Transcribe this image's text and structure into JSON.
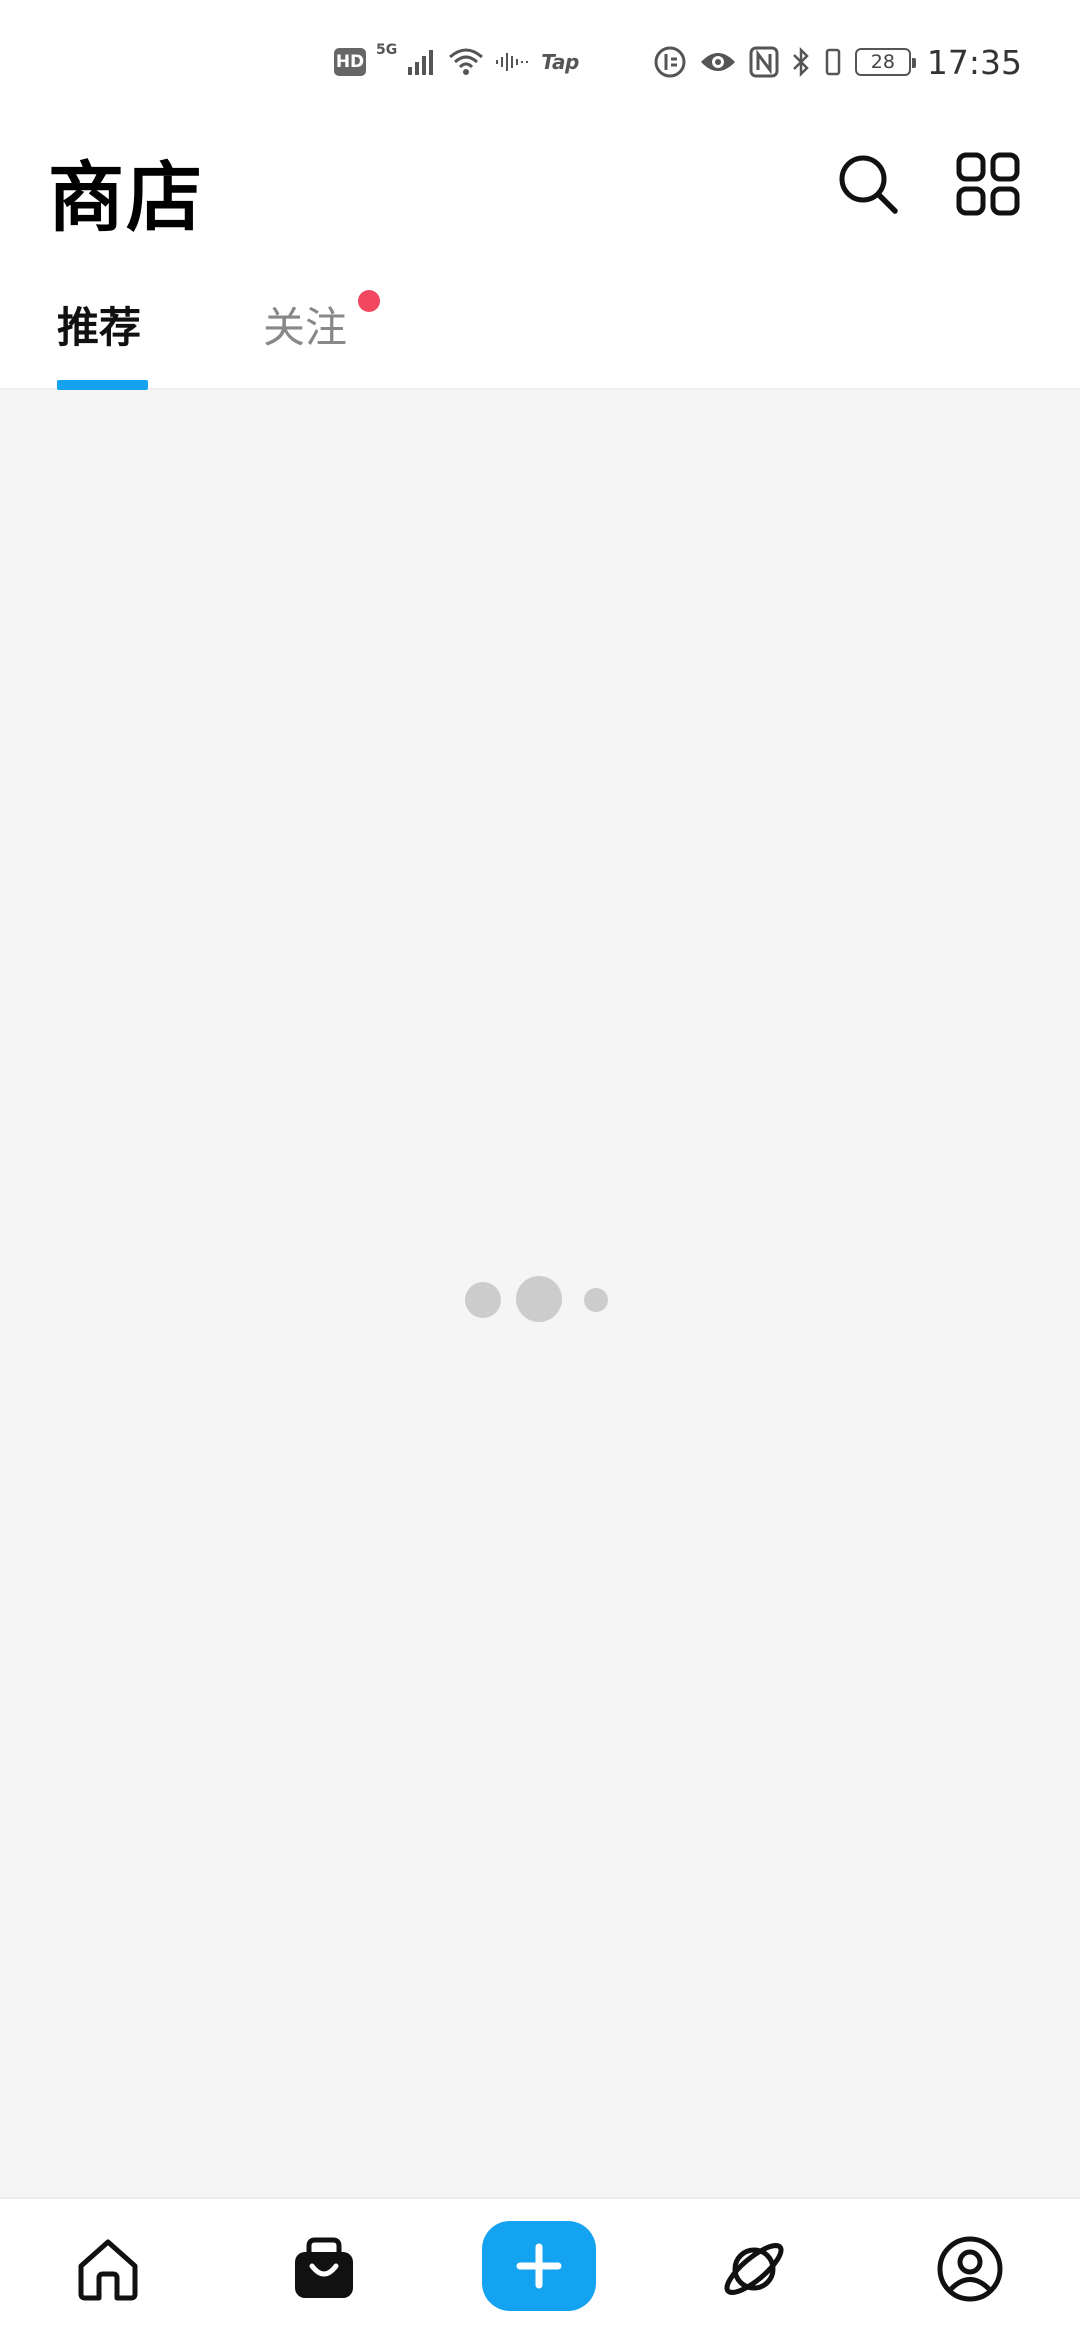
{
  "status_bar": {
    "hd_badge": "HD",
    "network": "5G",
    "tap_label": "Tap",
    "battery_level": "28",
    "time": "17:35"
  },
  "header": {
    "title": "商店",
    "icons": [
      "search-icon",
      "grid-icon"
    ]
  },
  "tabs": [
    {
      "label": "推荐",
      "active": true
    },
    {
      "label": "关注",
      "active": false,
      "has_notification_dot": true
    }
  ],
  "content": {
    "state": "loading"
  },
  "bottom_nav": {
    "items": [
      "home-icon",
      "shop-bag-icon",
      "plus-icon",
      "planet-icon",
      "profile-icon"
    ],
    "accent_color": "#14a3f0"
  },
  "colors": {
    "accent": "#14a3f0",
    "notification_dot": "#f2475e",
    "content_background": "#f5f5f5"
  }
}
